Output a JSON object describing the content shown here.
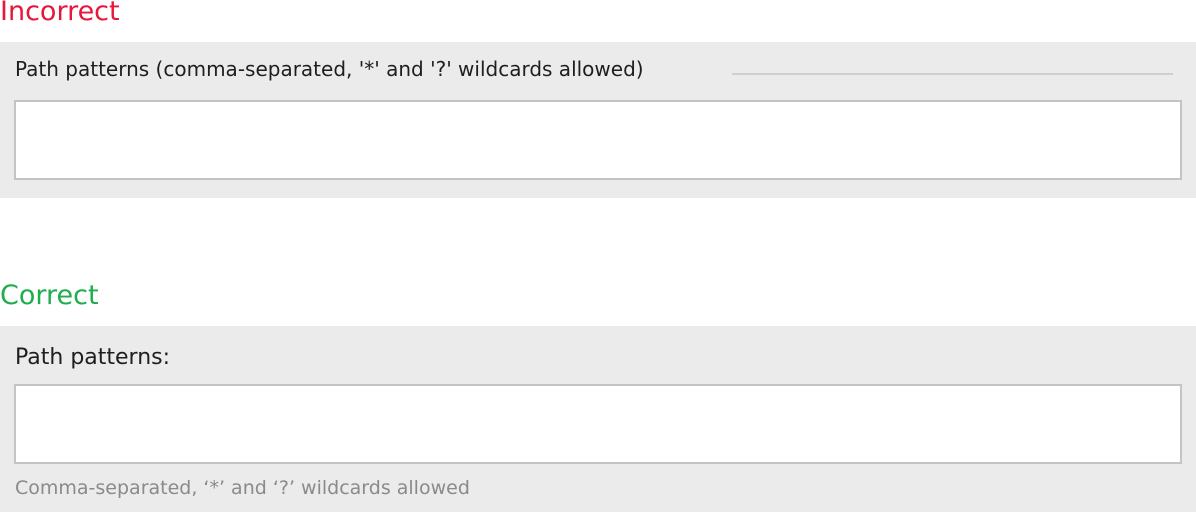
{
  "incorrect": {
    "heading": "Incorrect",
    "heading_color": "#e8163c",
    "label": "Path patterns (comma-separated, '*' and '?' wildcards allowed)",
    "field_value": ""
  },
  "correct": {
    "heading": "Correct",
    "heading_color": "#1fad4e",
    "label": "Path patterns:",
    "field_value": "",
    "hint": "Comma-separated, ‘*’ and ‘?’ wildcards allowed"
  },
  "colors": {
    "panel_background": "#ebebeb",
    "field_border": "#c4c4c4",
    "label_text": "#1e1e1e",
    "hint_text": "#8a8a8a"
  }
}
